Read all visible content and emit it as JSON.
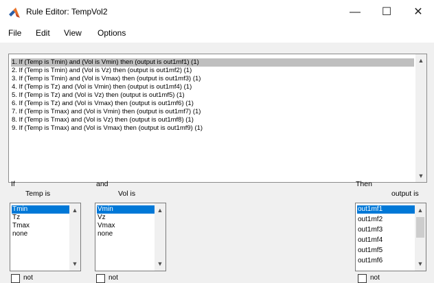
{
  "window": {
    "title": "Rule Editor: TempVol2",
    "minimize": "—",
    "maximize": "☐",
    "close": "✕"
  },
  "menu": [
    "File",
    "Edit",
    "View",
    "Options"
  ],
  "rules": [
    "1. If (Temp is Tmin) and (Vol is Vmin) then (output is out1mf1) (1)",
    "2. If (Temp is Tmin) and (Vol is Vz) then (output is out1mf2) (1)",
    "3. If (Temp is Tmin) and (Vol is Vmax) then (output is out1mf3) (1)",
    "4. If (Temp is Tz) and (Vol is Vmin) then (output is out1mf4) (1)",
    "5. If (Temp is Tz) and (Vol is Vz) then (output is out1mf5) (1)",
    "6. If (Temp is Tz) and (Vol is Vmax) then (output is out1mf6) (1)",
    "7. If (Temp is Tmax) and (Vol is Vmin) then (output is out1mf7) (1)",
    "8. If (Temp is Tmax) and (Vol is Vz) then (output is out1mf8) (1)",
    "9. If (Temp is Tmax) and (Vol is Vmax) then (output is out1mf9) (1)"
  ],
  "selected_rule": 0,
  "if_block": {
    "header": "If",
    "label": "Temp is",
    "options": [
      "Tmin",
      "Tz",
      "Tmax",
      "none"
    ],
    "not_label": "not"
  },
  "and_block": {
    "header": "and",
    "label": "Vol is",
    "options": [
      "Vmin",
      "Vz",
      "Vmax",
      "none"
    ],
    "not_label": "not"
  },
  "then_block": {
    "header": "Then",
    "label": "output is",
    "options": [
      "out1mf1",
      "out1mf2",
      "out1mf3",
      "out1mf4",
      "out1mf5",
      "out1mf6"
    ],
    "not_label": "not"
  },
  "icons": {
    "scroll_up": "▲",
    "scroll_down": "▼"
  },
  "colors": {
    "selection": "#0078d7",
    "rule_selection": "#bfbfbf"
  }
}
